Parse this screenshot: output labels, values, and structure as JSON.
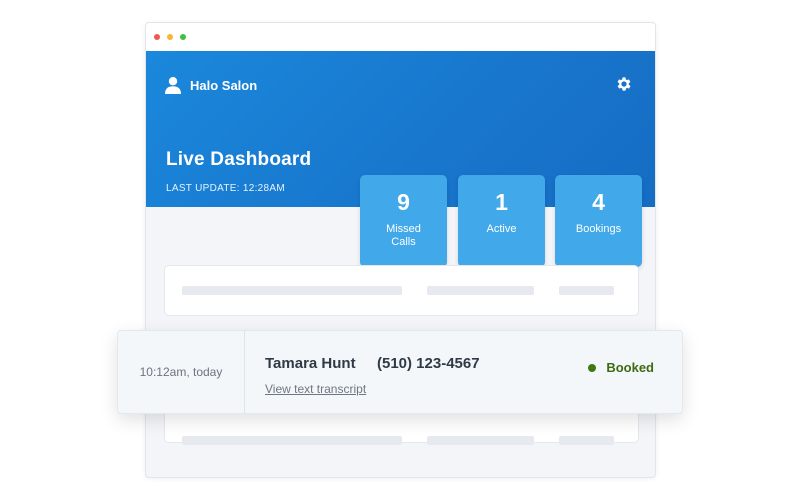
{
  "business": {
    "name": "Halo Salon",
    "user_icon": "user-icon",
    "settings_icon": "gear-icon"
  },
  "dashboard": {
    "title": "Live Dashboard",
    "last_update": "LAST UPDATE: 12:28AM"
  },
  "stats": [
    {
      "value": "9",
      "label": "Missed Calls"
    },
    {
      "value": "1",
      "label": "Active"
    },
    {
      "value": "4",
      "label": "Bookings"
    }
  ],
  "call": {
    "time": "10:12am, today",
    "name": "Tamara Hunt",
    "phone": "(510) 123-4567",
    "link_text": "View text transcript",
    "status": "Booked",
    "status_color": "#3e7a12"
  },
  "colors": {
    "header_blue": "#1a80d6",
    "stat_card_blue": "#41a8ea",
    "booked_green": "#3e7a12"
  }
}
